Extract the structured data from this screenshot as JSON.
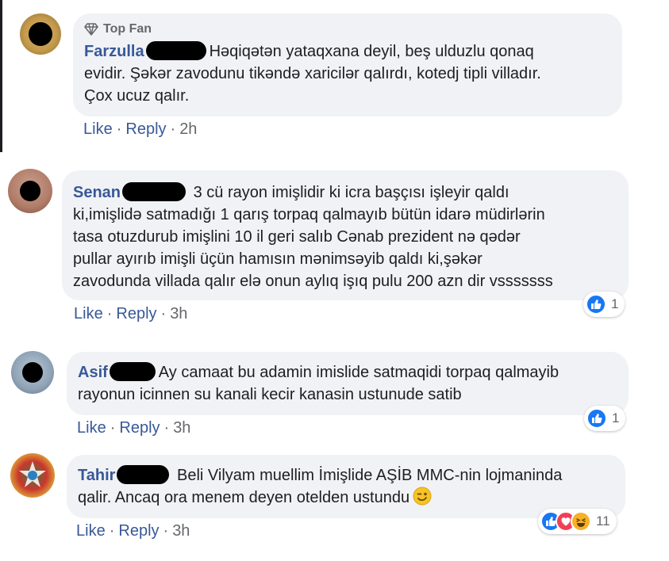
{
  "comments": [
    {
      "badge": "Top Fan",
      "author": "Farzulla",
      "lines": [
        "Həqiqətən yataqxana deyil, beş ulduzlu qonaq",
        "evidir. Şəkər zavodunu tikəndə xaricilər qalırdı, kotedj tipli villadır.",
        "Çox ucuz qalır."
      ],
      "like": "Like",
      "reply": "Reply",
      "time": "2h"
    },
    {
      "author": "Senan",
      "lines": [
        "3 cü rayon imişlidir ki icra başçısı işleyir qaldı",
        "ki,imişlidə satmadığı 1 qarış torpaq qalmayıb bütün idarə müdirlərin",
        "tasa otuzdurub imişlini 10 il geri salıb Cənab prezident nə qədər",
        "pullar ayırıb imişli üçün hamısın mənimsəyib qaldı ki,şəkər",
        "zavodunda villada qalır elə onun aylıq işıq pulu 200 azn dir vsssssss"
      ],
      "like": "Like",
      "reply": "Reply",
      "time": "3h",
      "reaction_count": "1"
    },
    {
      "author": "Asif",
      "lines": [
        "Ay camaat bu adamin imislide satmaqidi torpaq qalmayib",
        "rayonun icinnen su kanali kecir kanasin ustunude satib"
      ],
      "like": "Like",
      "reply": "Reply",
      "time": "3h",
      "reaction_count": "1"
    },
    {
      "author": "Tahir",
      "lines": [
        "Beli Vilyam muellim İmişlide AŞİB MMC-nin lojmaninda",
        "qalir. Ancaq ora menem deyen otelden ustundu"
      ],
      "like": "Like",
      "reply": "Reply",
      "time": "3h",
      "reaction_count": "11"
    }
  ],
  "separator": "·",
  "colors": {
    "bubble": "#f0f2f5",
    "author": "#385898",
    "meta": "#65676b",
    "like_reaction": "#1877f2",
    "love_reaction": "#f33e58",
    "haha_reaction": "#f7b125"
  },
  "icons": [
    "top-fan-diamond-icon",
    "like-reaction-icon",
    "love-reaction-icon",
    "haha-reaction-icon",
    "wink-emoji-icon"
  ]
}
